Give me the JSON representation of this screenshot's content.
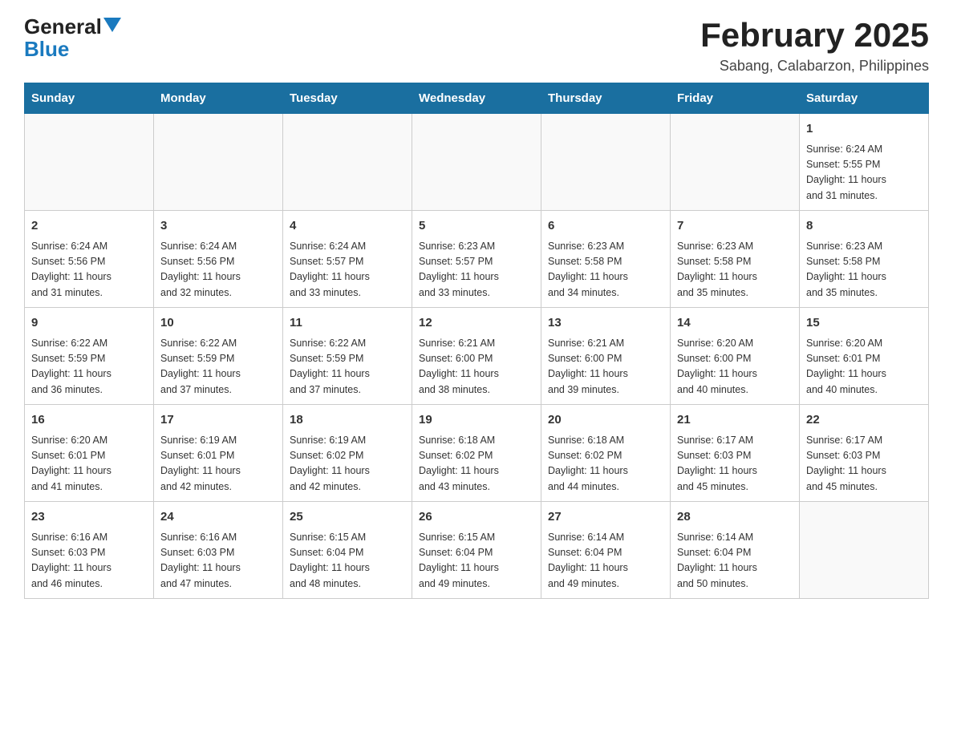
{
  "header": {
    "month_title": "February 2025",
    "location": "Sabang, Calabarzon, Philippines",
    "logo_general": "General",
    "logo_blue": "Blue"
  },
  "weekdays": [
    "Sunday",
    "Monday",
    "Tuesday",
    "Wednesday",
    "Thursday",
    "Friday",
    "Saturday"
  ],
  "weeks": [
    [
      {
        "day": "",
        "info": ""
      },
      {
        "day": "",
        "info": ""
      },
      {
        "day": "",
        "info": ""
      },
      {
        "day": "",
        "info": ""
      },
      {
        "day": "",
        "info": ""
      },
      {
        "day": "",
        "info": ""
      },
      {
        "day": "1",
        "info": "Sunrise: 6:24 AM\nSunset: 5:55 PM\nDaylight: 11 hours\nand 31 minutes."
      }
    ],
    [
      {
        "day": "2",
        "info": "Sunrise: 6:24 AM\nSunset: 5:56 PM\nDaylight: 11 hours\nand 31 minutes."
      },
      {
        "day": "3",
        "info": "Sunrise: 6:24 AM\nSunset: 5:56 PM\nDaylight: 11 hours\nand 32 minutes."
      },
      {
        "day": "4",
        "info": "Sunrise: 6:24 AM\nSunset: 5:57 PM\nDaylight: 11 hours\nand 33 minutes."
      },
      {
        "day": "5",
        "info": "Sunrise: 6:23 AM\nSunset: 5:57 PM\nDaylight: 11 hours\nand 33 minutes."
      },
      {
        "day": "6",
        "info": "Sunrise: 6:23 AM\nSunset: 5:58 PM\nDaylight: 11 hours\nand 34 minutes."
      },
      {
        "day": "7",
        "info": "Sunrise: 6:23 AM\nSunset: 5:58 PM\nDaylight: 11 hours\nand 35 minutes."
      },
      {
        "day": "8",
        "info": "Sunrise: 6:23 AM\nSunset: 5:58 PM\nDaylight: 11 hours\nand 35 minutes."
      }
    ],
    [
      {
        "day": "9",
        "info": "Sunrise: 6:22 AM\nSunset: 5:59 PM\nDaylight: 11 hours\nand 36 minutes."
      },
      {
        "day": "10",
        "info": "Sunrise: 6:22 AM\nSunset: 5:59 PM\nDaylight: 11 hours\nand 37 minutes."
      },
      {
        "day": "11",
        "info": "Sunrise: 6:22 AM\nSunset: 5:59 PM\nDaylight: 11 hours\nand 37 minutes."
      },
      {
        "day": "12",
        "info": "Sunrise: 6:21 AM\nSunset: 6:00 PM\nDaylight: 11 hours\nand 38 minutes."
      },
      {
        "day": "13",
        "info": "Sunrise: 6:21 AM\nSunset: 6:00 PM\nDaylight: 11 hours\nand 39 minutes."
      },
      {
        "day": "14",
        "info": "Sunrise: 6:20 AM\nSunset: 6:00 PM\nDaylight: 11 hours\nand 40 minutes."
      },
      {
        "day": "15",
        "info": "Sunrise: 6:20 AM\nSunset: 6:01 PM\nDaylight: 11 hours\nand 40 minutes."
      }
    ],
    [
      {
        "day": "16",
        "info": "Sunrise: 6:20 AM\nSunset: 6:01 PM\nDaylight: 11 hours\nand 41 minutes."
      },
      {
        "day": "17",
        "info": "Sunrise: 6:19 AM\nSunset: 6:01 PM\nDaylight: 11 hours\nand 42 minutes."
      },
      {
        "day": "18",
        "info": "Sunrise: 6:19 AM\nSunset: 6:02 PM\nDaylight: 11 hours\nand 42 minutes."
      },
      {
        "day": "19",
        "info": "Sunrise: 6:18 AM\nSunset: 6:02 PM\nDaylight: 11 hours\nand 43 minutes."
      },
      {
        "day": "20",
        "info": "Sunrise: 6:18 AM\nSunset: 6:02 PM\nDaylight: 11 hours\nand 44 minutes."
      },
      {
        "day": "21",
        "info": "Sunrise: 6:17 AM\nSunset: 6:03 PM\nDaylight: 11 hours\nand 45 minutes."
      },
      {
        "day": "22",
        "info": "Sunrise: 6:17 AM\nSunset: 6:03 PM\nDaylight: 11 hours\nand 45 minutes."
      }
    ],
    [
      {
        "day": "23",
        "info": "Sunrise: 6:16 AM\nSunset: 6:03 PM\nDaylight: 11 hours\nand 46 minutes."
      },
      {
        "day": "24",
        "info": "Sunrise: 6:16 AM\nSunset: 6:03 PM\nDaylight: 11 hours\nand 47 minutes."
      },
      {
        "day": "25",
        "info": "Sunrise: 6:15 AM\nSunset: 6:04 PM\nDaylight: 11 hours\nand 48 minutes."
      },
      {
        "day": "26",
        "info": "Sunrise: 6:15 AM\nSunset: 6:04 PM\nDaylight: 11 hours\nand 49 minutes."
      },
      {
        "day": "27",
        "info": "Sunrise: 6:14 AM\nSunset: 6:04 PM\nDaylight: 11 hours\nand 49 minutes."
      },
      {
        "day": "28",
        "info": "Sunrise: 6:14 AM\nSunset: 6:04 PM\nDaylight: 11 hours\nand 50 minutes."
      },
      {
        "day": "",
        "info": ""
      }
    ]
  ]
}
